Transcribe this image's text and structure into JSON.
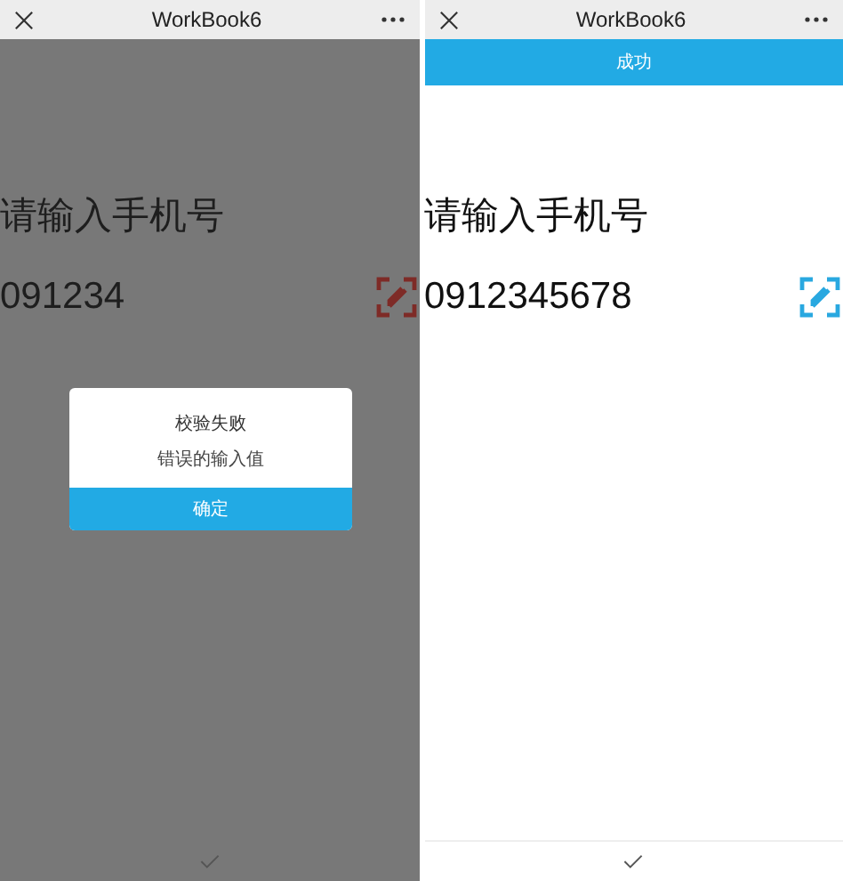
{
  "screens": [
    {
      "title": "WorkBook6",
      "prompt": "请输入手机号",
      "value": "091234",
      "color": "#7e2b27",
      "dimmed": true,
      "dialog": {
        "title": "校验失败",
        "message": "错误的输入值",
        "button": "确定"
      }
    },
    {
      "title": "WorkBook6",
      "banner": "成功",
      "prompt": "请输入手机号",
      "value": "0912345678",
      "color": "#29a8e0",
      "dimmed": false
    }
  ]
}
